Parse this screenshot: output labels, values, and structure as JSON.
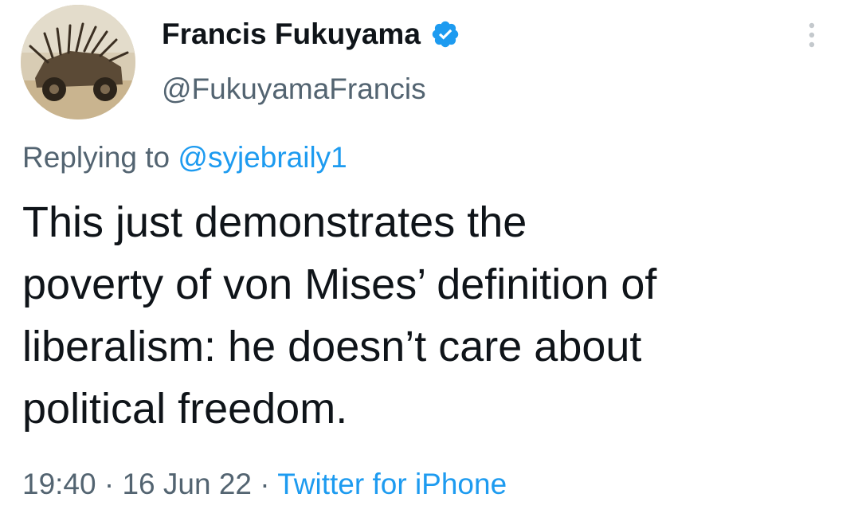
{
  "author": {
    "name": "Francis Fukuyama",
    "handle": "@FukuyamaFrancis",
    "verified": true,
    "avatar_icon": "avatar-spiked-vehicle-image"
  },
  "more_icon": "more-options-icon",
  "reply": {
    "prefix": "Replying to",
    "mention": "@syjebraily1"
  },
  "tweet": {
    "lines": [
      "This just demonstrates the",
      "poverty of von Mises’ definition of",
      "liberalism: he doesn’t care about",
      "political freedom."
    ]
  },
  "meta": {
    "time": "19:40",
    "separator": "·",
    "date": "16 Jun 22",
    "source": "Twitter for iPhone"
  },
  "colors": {
    "text": "#0f1419",
    "secondary": "#536471",
    "link": "#1d9bf0",
    "verified_badge": "#1d9bf0"
  }
}
